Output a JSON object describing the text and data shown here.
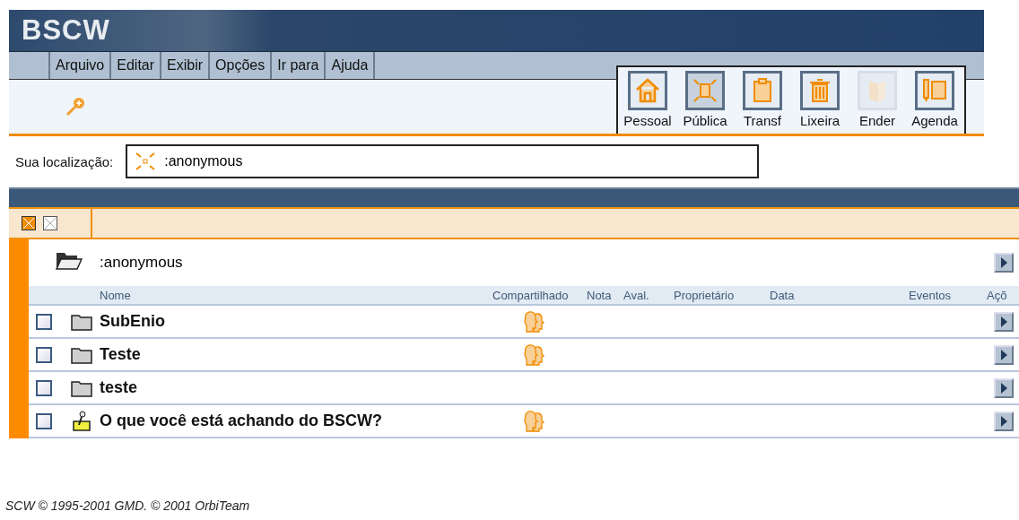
{
  "logo": "BSCW",
  "menu": [
    "Arquivo",
    "Editar",
    "Exibir",
    "Opções",
    "Ir para",
    "Ajuda"
  ],
  "toolbar": [
    {
      "label": "Pessoal",
      "kind": "home",
      "selected": false,
      "disabled": false
    },
    {
      "label": "Pública",
      "kind": "public",
      "selected": true,
      "disabled": false
    },
    {
      "label": "Transf",
      "kind": "clipboard",
      "selected": false,
      "disabled": false
    },
    {
      "label": "Lixeira",
      "kind": "trash",
      "selected": false,
      "disabled": false
    },
    {
      "label": "Ender",
      "kind": "book",
      "selected": false,
      "disabled": true
    },
    {
      "label": "Agenda",
      "kind": "calendar",
      "selected": false,
      "disabled": false
    }
  ],
  "location": {
    "label": "Sua localização:",
    "value": ":anonymous"
  },
  "folder": {
    "name": ":anonymous"
  },
  "columns": [
    "Nome",
    "Compartilhado",
    "Nota",
    "Aval.",
    "Proprietário",
    "Data",
    "Eventos",
    "Açõ"
  ],
  "rows": [
    {
      "name": "SubEnio",
      "kind": "folder",
      "checked": false,
      "shared": true
    },
    {
      "name": "Teste",
      "kind": "folder",
      "checked": false,
      "shared": true
    },
    {
      "name": "teste",
      "kind": "folder",
      "checked": false,
      "shared": false
    },
    {
      "name": "O que você está achando do BSCW?",
      "kind": "poll",
      "checked": false,
      "shared": true
    }
  ],
  "footer": "SCW © 1995-2001 GMD. © 2001 OrbiTeam"
}
